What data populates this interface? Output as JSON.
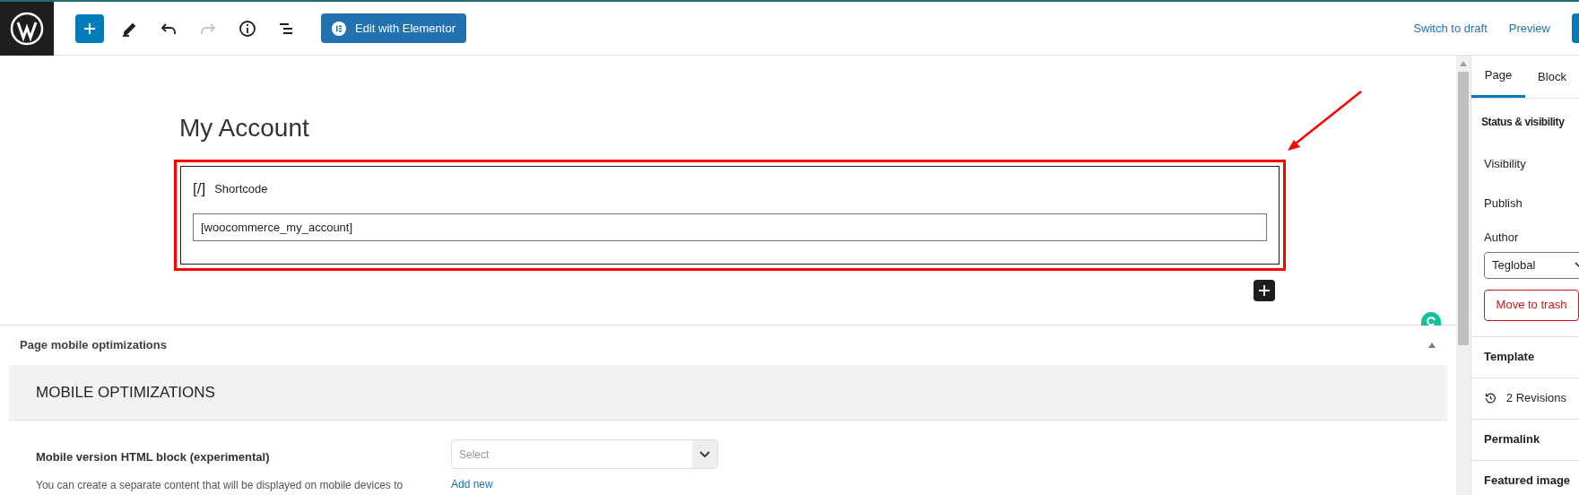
{
  "toolbar": {
    "tools": [
      {
        "kind": "add",
        "disabled": false
      },
      {
        "kind": "edit",
        "disabled": false
      },
      {
        "kind": "undo",
        "disabled": false
      },
      {
        "kind": "redo",
        "disabled": true
      },
      {
        "kind": "info",
        "disabled": false
      },
      {
        "kind": "outline",
        "disabled": false
      }
    ],
    "elementor_button": "Edit with Elementor",
    "switch_to_draft": "Switch to draft",
    "preview": "Preview"
  },
  "editor": {
    "title": "My Account",
    "block": {
      "icon_text": "[/]",
      "label": "Shortcode",
      "value": "[woocommerce_my_account]",
      "highlighted": true
    }
  },
  "meta_box": {
    "title": "Page mobile optimizations",
    "expanded": true,
    "heading": "MOBILE OPTIMIZATIONS",
    "field_label": "Mobile version HTML block (experimental)",
    "select_placeholder": "Select",
    "description": "You can create a separate content that will be displayed on mobile devices to",
    "add_new": "Add new"
  },
  "sidebar": {
    "tabs": [
      {
        "label": "Page",
        "selected": true
      },
      {
        "label": "Block",
        "selected": false
      }
    ],
    "status_title": "Status & visibility",
    "visibility": "Visibility",
    "publish": "Publish",
    "author_label": "Author",
    "author_value": "Teglobal",
    "trash": "Move to trash",
    "sections": [
      {
        "kind": "plain",
        "label": "Template"
      },
      {
        "kind": "revisions",
        "label": "2 Revisions"
      },
      {
        "kind": "plain",
        "label": "Permalink"
      },
      {
        "kind": "plain",
        "label": "Featured image"
      }
    ]
  }
}
